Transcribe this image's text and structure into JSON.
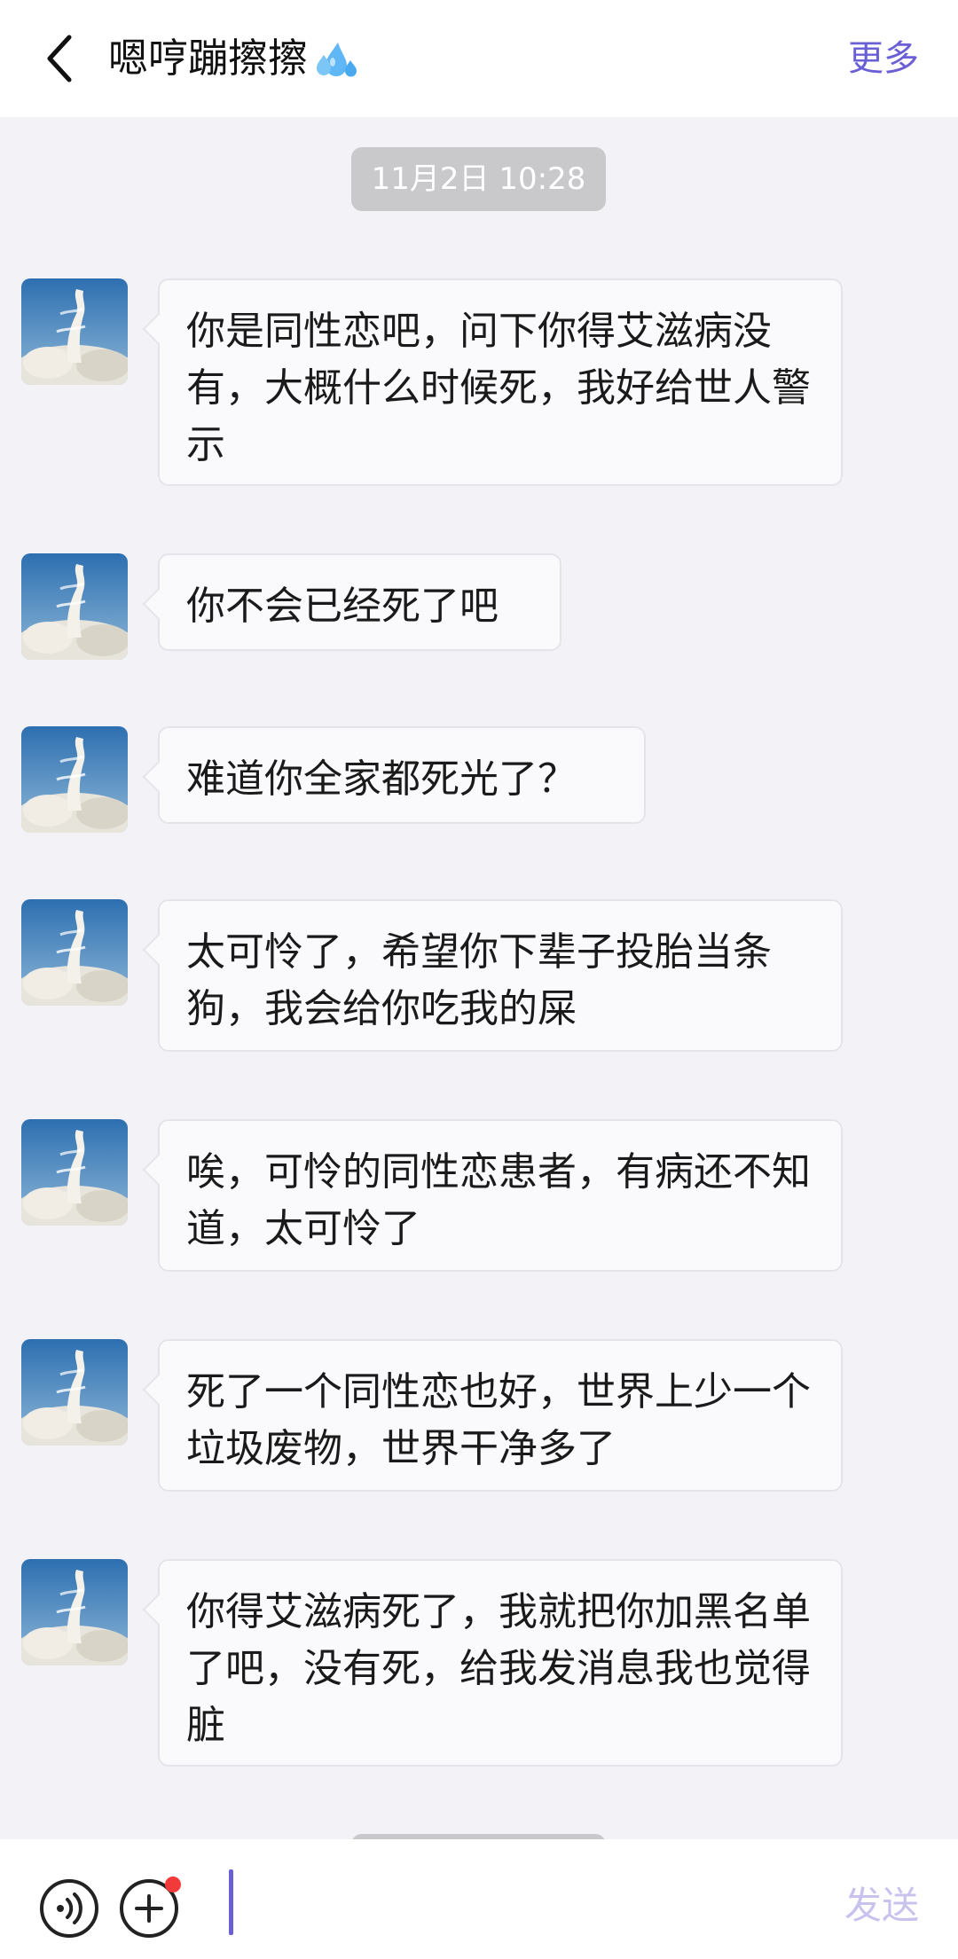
{
  "header": {
    "back_icon": "chevron-left-icon",
    "title": "嗯哼蹦擦擦",
    "title_emoji_icon": "sweat-droplets-icon",
    "more_label": "更多",
    "accent_color": "#6b5fd6"
  },
  "chat": {
    "timestamp": "11月2日 10:28",
    "messages": [
      {
        "text": "你是同性恋吧，问下你得艾滋病没有，大概什么时候死，我好给世人警示"
      },
      {
        "text": "你不会已经死了吧"
      },
      {
        "text": "难道你全家都死光了？"
      },
      {
        "text": "太可怜了，希望你下辈子投胎当条狗，我会给你吃我的屎"
      },
      {
        "text": "唉，可怜的同性恋患者，有病还不知道，太可怜了"
      },
      {
        "text": "死了一个同性恋也好，世界上少一个垃圾废物，世界干净多了"
      },
      {
        "text": "你得艾滋病死了，我就把你加黑名单了吧，没有死，给我发消息我也觉得脏"
      }
    ]
  },
  "input_bar": {
    "voice_icon": "voice-icon",
    "plus_icon": "plus-icon",
    "input_value": "",
    "send_label": "发送",
    "badge_color": "#f23a3a"
  }
}
